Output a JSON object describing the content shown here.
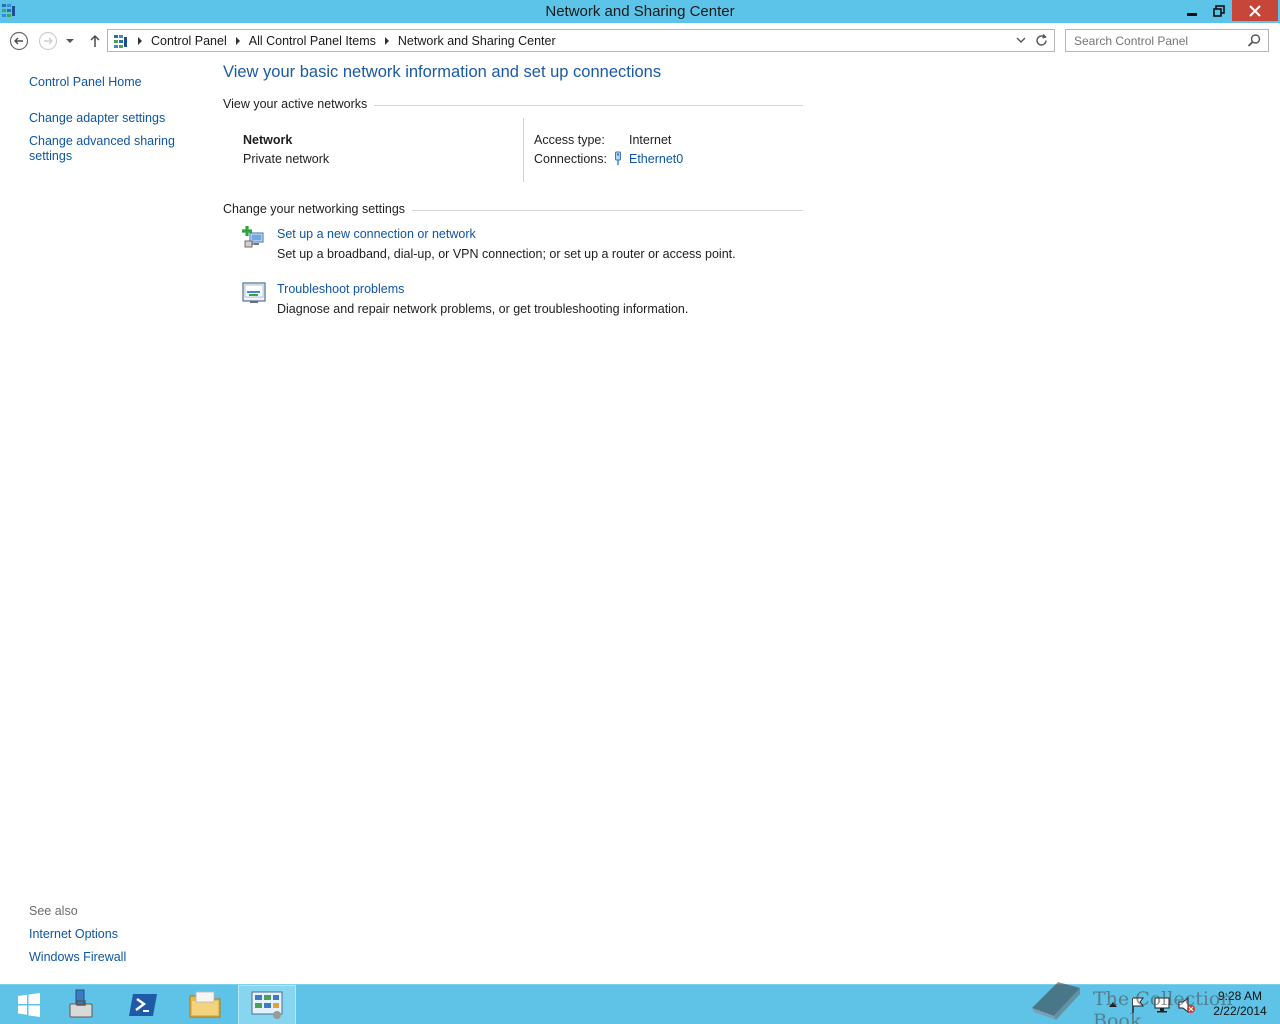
{
  "window": {
    "title": "Network and Sharing Center"
  },
  "navigation": {
    "breadcrumbs": [
      "Control Panel",
      "All Control Panel Items",
      "Network and Sharing Center"
    ],
    "search_placeholder": "Search Control Panel"
  },
  "left_pane": {
    "links": [
      "Control Panel Home",
      "Change adapter settings",
      "Change advanced sharing settings"
    ],
    "see_also_label": "See also",
    "see_also_links": [
      "Internet Options",
      "Windows Firewall"
    ]
  },
  "main": {
    "heading": "View your basic network information and set up connections",
    "active_networks": {
      "section_title": "View your active networks",
      "network_name": "Network",
      "network_category": "Private network",
      "access_type_label": "Access type:",
      "access_type_value": "Internet",
      "connections_label": "Connections:",
      "connections_value": "Ethernet0"
    },
    "change_settings": {
      "section_title": "Change your networking settings",
      "tasks": [
        {
          "title": "Set up a new connection or network",
          "description": "Set up a broadband, dial-up, or VPN connection; or set up a router or access point.",
          "icon": "new-connection-icon"
        },
        {
          "title": "Troubleshoot problems",
          "description": "Diagnose and repair network problems, or get troubleshooting information.",
          "icon": "troubleshoot-icon"
        }
      ]
    }
  },
  "taskbar": {
    "items": [
      "start-icon",
      "server-manager-icon",
      "powershell-icon",
      "file-explorer-icon",
      "control-panel-icon"
    ],
    "active_item": "control-panel-icon",
    "clock_time": "9:28 AM",
    "clock_date": "2/22/2014",
    "watermark": "The Collection Book"
  },
  "colors": {
    "titlebar": "#5bc4e8",
    "close_button": "#c7463a",
    "link": "#0e56a5",
    "heading": "#1a5aa6",
    "taskbar": "#5ec3e7"
  }
}
